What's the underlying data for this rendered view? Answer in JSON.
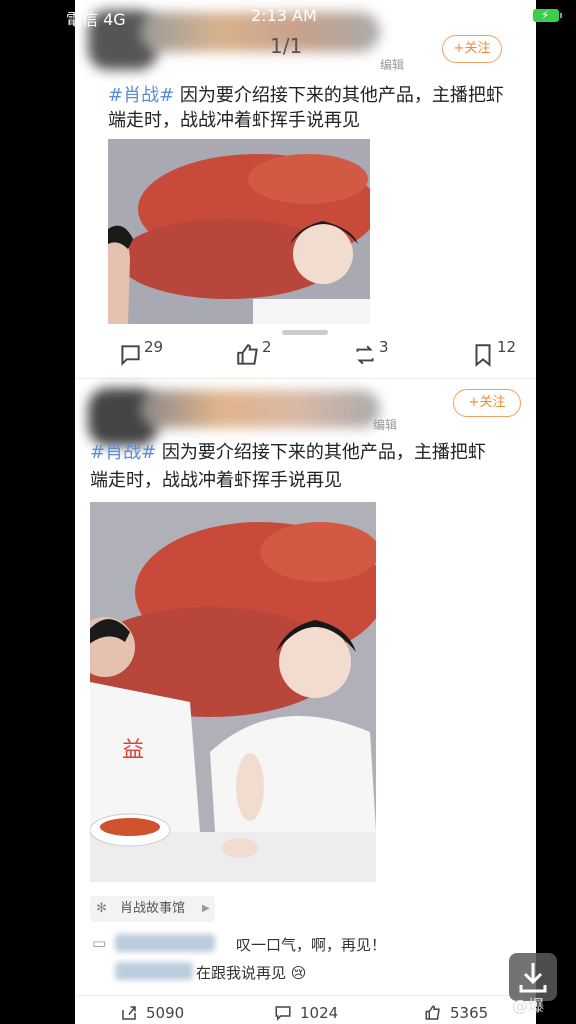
{
  "status_bar": {
    "carrier": "電信  4G",
    "time": "2:13 AM",
    "battery": "99%"
  },
  "pager": "1/1",
  "post_top": {
    "edited": "编辑",
    "follow": "+关注",
    "hashtag": "#肖战#",
    "line1": " 因为要介绍接下来的其他产品，主播把虾",
    "line2": "端走时，战战冲着虾挥手说再见",
    "actions": {
      "comments": "29",
      "likes": "2",
      "reposts": "3",
      "bookmarks": "12"
    }
  },
  "post_bottom": {
    "edited": "编辑",
    "follow": "+关注",
    "hashtag": "#肖战#",
    "line1": " 因为要介绍接下来的其他产品，主播把虾",
    "line2": "端走时，战战冲着虾挥手说再见",
    "source": "肖战故事馆",
    "comments": [
      "叹一口气，啊，再见！",
      "在跟我说再见 😢"
    ],
    "stats": {
      "reposts": "5090",
      "comments": "1024",
      "likes": "5365"
    }
  },
  "watermark": "@爆",
  "colors": {
    "tag": "#5b8dd6",
    "follow": "#f08a30",
    "battery": "#3ccd4b"
  }
}
